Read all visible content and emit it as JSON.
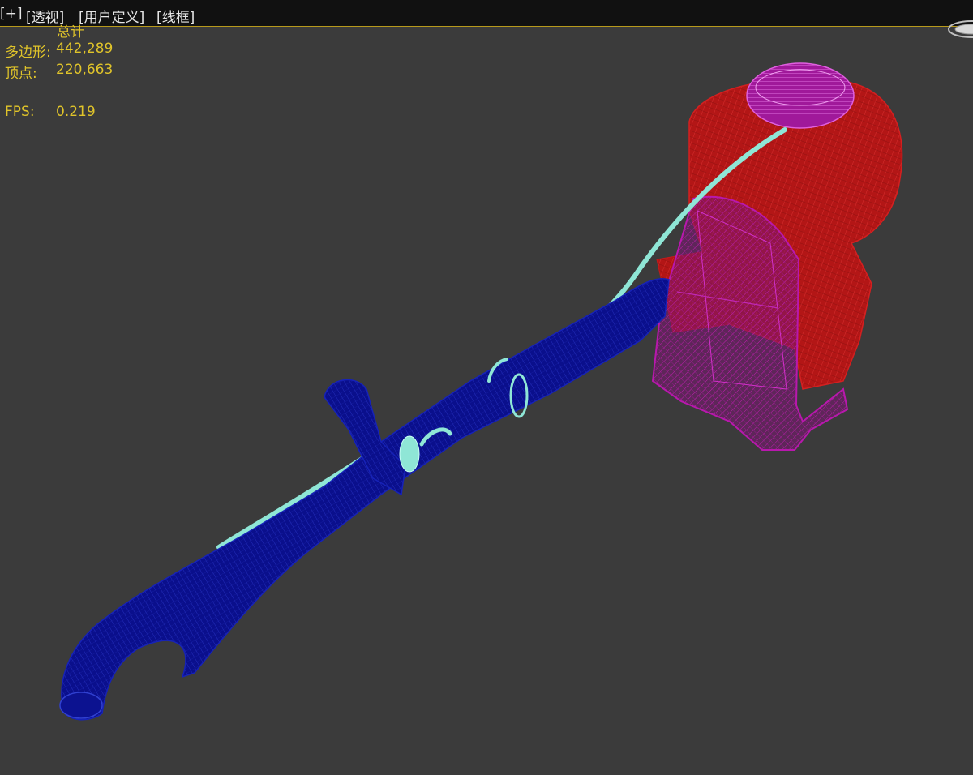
{
  "viewport": {
    "labels": {
      "plus": "[+]",
      "perspective": "[透视]",
      "user_defined": "[用户定义]",
      "wireframe": "[线框]"
    }
  },
  "stats": {
    "total_label": "总计",
    "polygons_label": "多边形:",
    "polygons_value": "442,289",
    "vertices_label": "顶点:",
    "vertices_value": "220,663",
    "fps_label": "FPS:",
    "fps_value": "0.219"
  },
  "scene": {
    "object": "backpack-leaf-blower-wireframe",
    "colors": {
      "background": "#3b3b3b",
      "tube": "#0a0f8c",
      "engine": "#c21818",
      "frame": "#9a1590",
      "hose": "#8fe6d6",
      "stats_text": "#e0c42a"
    }
  }
}
